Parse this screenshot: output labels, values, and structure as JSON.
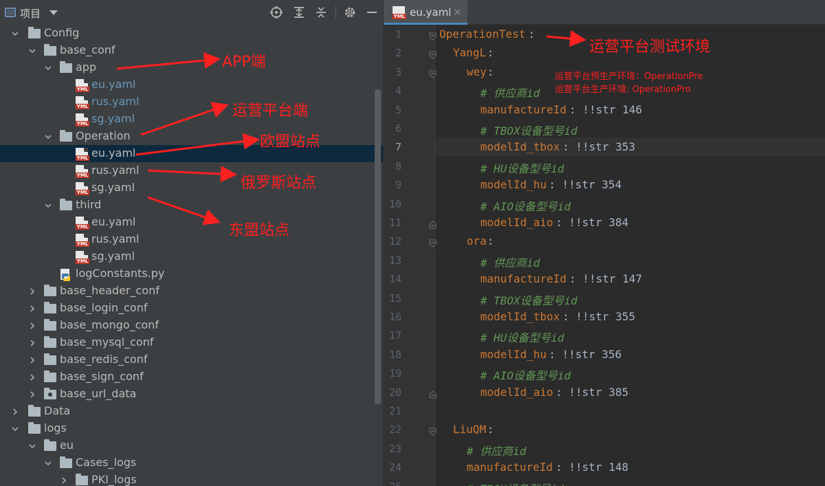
{
  "panel": {
    "title": "项目",
    "toolbar_icons": [
      "crosshair-icon",
      "expand-all-icon",
      "collapse-all-icon",
      "gear-icon",
      "minimize-icon"
    ]
  },
  "tree": [
    {
      "label": "Config",
      "type": "folder",
      "depth": 1,
      "expanded": true
    },
    {
      "label": "base_conf",
      "type": "folder",
      "depth": 2,
      "expanded": true
    },
    {
      "label": "app",
      "type": "folder",
      "depth": 3,
      "expanded": true
    },
    {
      "label": "eu.yaml",
      "type": "yaml",
      "depth": 4,
      "color": "#6897bb"
    },
    {
      "label": "rus.yaml",
      "type": "yaml",
      "depth": 4,
      "color": "#6897bb"
    },
    {
      "label": "sg.yaml",
      "type": "yaml",
      "depth": 4,
      "color": "#6897bb"
    },
    {
      "label": "Operation",
      "type": "folder",
      "depth": 3,
      "expanded": true
    },
    {
      "label": "eu.yaml",
      "type": "yaml",
      "depth": 4,
      "selected": true
    },
    {
      "label": "rus.yaml",
      "type": "yaml",
      "depth": 4
    },
    {
      "label": "sg.yaml",
      "type": "yaml",
      "depth": 4
    },
    {
      "label": "third",
      "type": "folder",
      "depth": 3,
      "expanded": true
    },
    {
      "label": "eu.yaml",
      "type": "yaml",
      "depth": 4
    },
    {
      "label": "rus.yaml",
      "type": "yaml",
      "depth": 4
    },
    {
      "label": "sg.yaml",
      "type": "yaml",
      "depth": 4
    },
    {
      "label": "logConstants.py",
      "type": "python",
      "depth": 3
    },
    {
      "label": "base_header_conf",
      "type": "folder",
      "depth": 2,
      "expanded": false
    },
    {
      "label": "base_login_conf",
      "type": "folder",
      "depth": 2,
      "expanded": false
    },
    {
      "label": "base_mongo_conf",
      "type": "folder",
      "depth": 2,
      "expanded": false
    },
    {
      "label": "base_mysql_conf",
      "type": "folder",
      "depth": 2,
      "expanded": false
    },
    {
      "label": "base_redis_conf",
      "type": "folder",
      "depth": 2,
      "expanded": false
    },
    {
      "label": "base_sign_conf",
      "type": "folder",
      "depth": 2,
      "expanded": false
    },
    {
      "label": "base_url_data",
      "type": "data-folder",
      "depth": 2,
      "expanded": false
    },
    {
      "label": "Data",
      "type": "folder",
      "depth": 1,
      "expanded": false
    },
    {
      "label": "logs",
      "type": "folder",
      "depth": 1,
      "expanded": true
    },
    {
      "label": "eu",
      "type": "folder",
      "depth": 2,
      "expanded": true
    },
    {
      "label": "Cases_logs",
      "type": "folder",
      "depth": 3,
      "expanded": true
    },
    {
      "label": "PKI_logs",
      "type": "folder",
      "depth": 4,
      "expanded": false
    }
  ],
  "editor": {
    "tab_label": "eu.yaml",
    "tab_close": "×",
    "current_line": 7,
    "lines": [
      {
        "n": "1",
        "indent": 0,
        "key": "OperationTest",
        "rest": ":",
        "kind": "key",
        "fold": "open"
      },
      {
        "n": "2",
        "indent": 2,
        "key": "YangL",
        "rest": ":",
        "kind": "key",
        "fold": "open"
      },
      {
        "n": "3",
        "indent": 4,
        "key": "wey",
        "rest": ":",
        "kind": "key",
        "fold": "open"
      },
      {
        "n": "4",
        "indent": 6,
        "comment": "# 供应商id",
        "kind": "comment"
      },
      {
        "n": "5",
        "indent": 6,
        "key": "manufactureId",
        "rest": ": !!str 146",
        "kind": "key"
      },
      {
        "n": "6",
        "indent": 6,
        "comment": "# TBOX设备型号id",
        "kind": "comment"
      },
      {
        "n": "7",
        "indent": 6,
        "key": "modelId_tbox",
        "rest": ": !!str 353",
        "kind": "key"
      },
      {
        "n": "8",
        "indent": 6,
        "comment": "# HU设备型号id",
        "kind": "comment"
      },
      {
        "n": "9",
        "indent": 6,
        "key": "modelId_hu",
        "rest": ": !!str 354",
        "kind": "key"
      },
      {
        "n": "10",
        "indent": 6,
        "comment": "# AIO设备型号id",
        "kind": "comment"
      },
      {
        "n": "11",
        "indent": 6,
        "key": "modelId_aio",
        "rest": ": !!str 384",
        "kind": "key",
        "fold": "close"
      },
      {
        "n": "12",
        "indent": 4,
        "key": "ora",
        "rest": ":",
        "kind": "key",
        "fold": "open"
      },
      {
        "n": "13",
        "indent": 6,
        "comment": "# 供应商id",
        "kind": "comment"
      },
      {
        "n": "14",
        "indent": 6,
        "key": "manufactureId",
        "rest": ": !!str 147",
        "kind": "key"
      },
      {
        "n": "15",
        "indent": 6,
        "comment": "# TBOX设备型号id",
        "kind": "comment"
      },
      {
        "n": "16",
        "indent": 6,
        "key": "modelId_tbox",
        "rest": ": !!str 355",
        "kind": "key"
      },
      {
        "n": "17",
        "indent": 6,
        "comment": "# HU设备型号id",
        "kind": "comment"
      },
      {
        "n": "18",
        "indent": 6,
        "key": "modelId_hu",
        "rest": ": !!str 356",
        "kind": "key"
      },
      {
        "n": "19",
        "indent": 6,
        "comment": "# AIO设备型号id",
        "kind": "comment"
      },
      {
        "n": "20",
        "indent": 6,
        "key": "modelId_aio",
        "rest": ": !!str 385",
        "kind": "key",
        "fold": "close"
      },
      {
        "n": "21",
        "indent": 0,
        "kind": "blank"
      },
      {
        "n": "22",
        "indent": 2,
        "key": "LiuQM",
        "rest": ":",
        "kind": "key",
        "fold": "open"
      },
      {
        "n": "23",
        "indent": 4,
        "comment": "# 供应商id",
        "kind": "comment"
      },
      {
        "n": "24",
        "indent": 4,
        "key": "manufactureId",
        "rest": ": !!str 148",
        "kind": "key"
      },
      {
        "n": "25",
        "indent": 4,
        "comment": "# TBOX设备型号id",
        "kind": "comment"
      }
    ]
  },
  "annotations": {
    "app_end": "APP端",
    "operation_end": "运营平台端",
    "eu_site": "欧盟站点",
    "rus_site": "俄罗斯站点",
    "asean_site": "东盟站点",
    "test_env": "运营平台测试环境",
    "pre_env": "运营平台预生产环境：OperationPre",
    "prod_env": "运营平台生产环境: OperationPro"
  }
}
